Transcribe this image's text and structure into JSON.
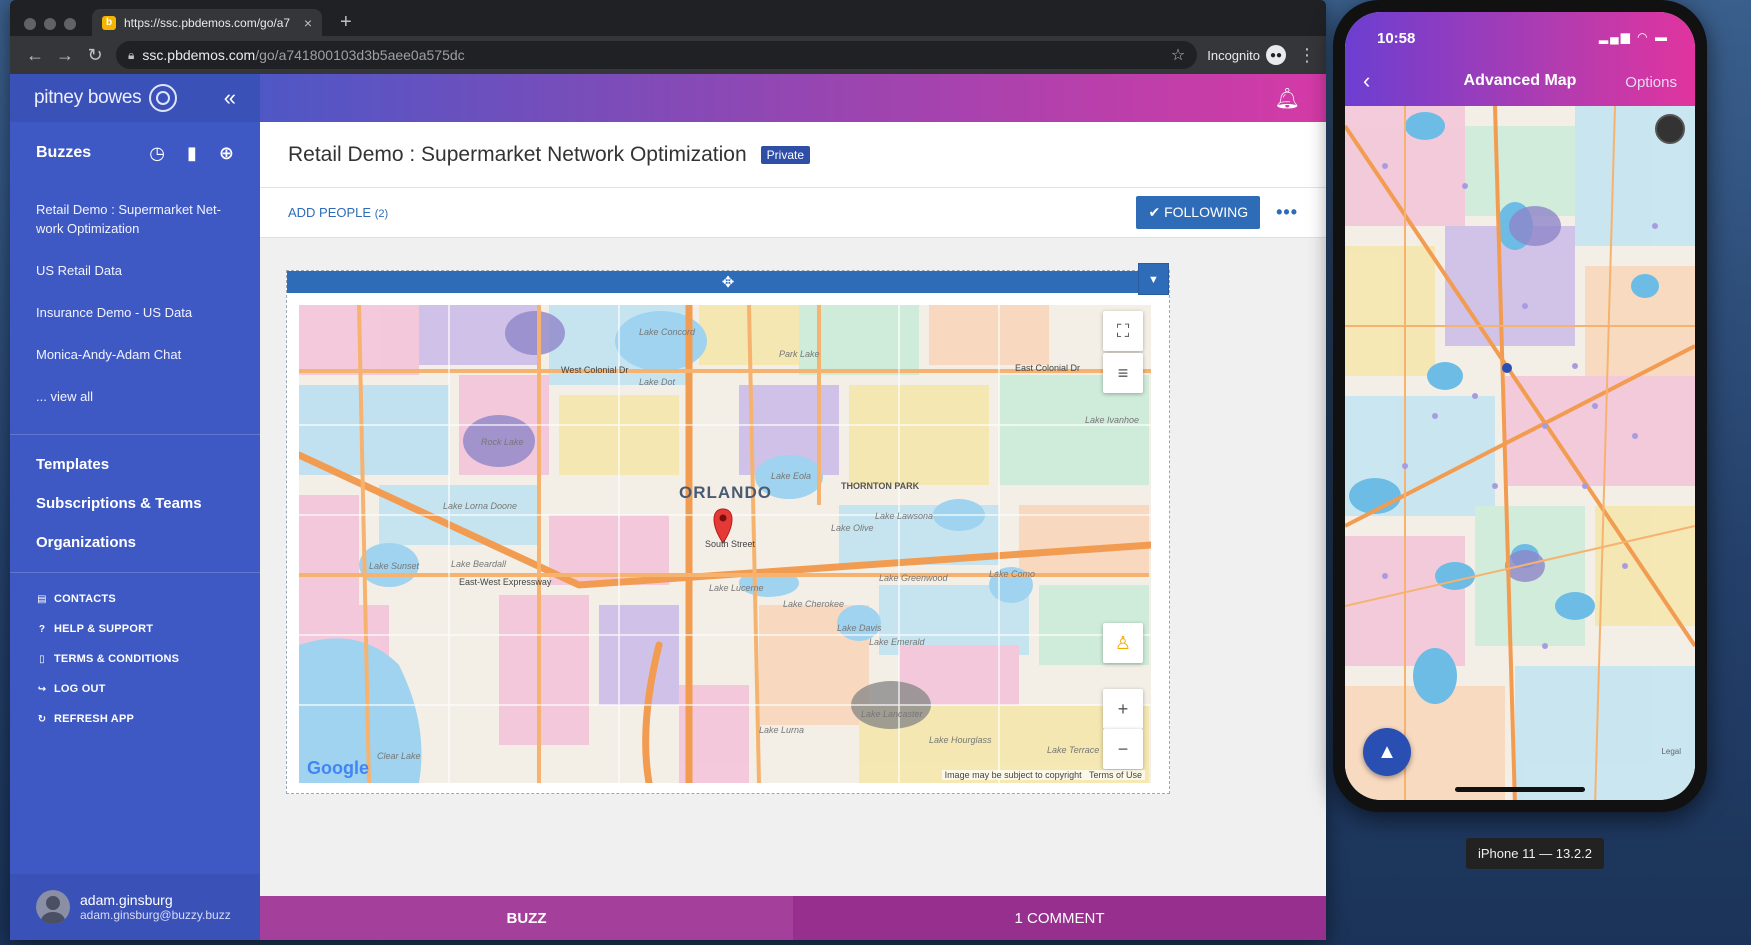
{
  "browser": {
    "tab_title": "https://ssc.pbdemos.com/go/a7",
    "tab_favicon": "b",
    "url_host": "ssc.pbdemos.com",
    "url_path": "/go/a741800103d3b5aee0a575dc",
    "incognito_label": "Incognito"
  },
  "sidebar": {
    "brand": "pitney bowes",
    "section_title": "Buzzes",
    "buzzes": [
      "Retail Demo : Supermarket Net-work Optimization",
      "US Retail Data",
      "Insurance Demo - US Data",
      "Monica-Andy-Adam Chat",
      "... view all"
    ],
    "main_links": [
      "Templates",
      "Subscriptions & Teams",
      "Organizations"
    ],
    "utility_links": [
      {
        "label": "CONTACTS",
        "icon": "book-icon"
      },
      {
        "label": "HELP & SUPPORT",
        "icon": "question-icon"
      },
      {
        "label": "TERMS & CONDITIONS",
        "icon": "document-icon"
      },
      {
        "label": "LOG OUT",
        "icon": "logout-icon"
      },
      {
        "label": "REFRESH APP",
        "icon": "refresh-icon"
      }
    ],
    "user": {
      "name": "adam.ginsburg",
      "email": "adam.ginsburg@buzzy.buzz"
    }
  },
  "main": {
    "title": "Retail Demo : Supermarket Network Optimization",
    "privacy_badge": "Private",
    "add_people_label": "ADD PEOPLE",
    "add_people_count": "(2)",
    "following_label": "FOLLOWING",
    "more_label": "•••"
  },
  "map": {
    "city_label": "ORLANDO",
    "labels": [
      "Lake Concord",
      "Park Lake",
      "Lake Dot",
      "Rock Lake",
      "Lake Eola",
      "THORNTON PARK",
      "Lake Lawsona",
      "Lake Olive",
      "Lake Lorna Doone",
      "Lake Sunset",
      "Lake Beardall",
      "Lake Lucerne",
      "Lake Cherokee",
      "Lake Greenwood",
      "Lake Como",
      "Lake Davis",
      "Lake Emerald",
      "Lake Lancaster",
      "Lake Hourglass",
      "Lake Terrace",
      "Clear Lake",
      "Lake Lurna",
      "Lake Ivanhoe",
      "South Street",
      "East-West Expressway",
      "West Colonial Dr",
      "East Colonial Dr"
    ],
    "copyright": "Image may be subject to copyright",
    "terms": "Terms of Use",
    "google": "Google"
  },
  "bottom": {
    "buzz_label": "BUZZ",
    "comment_label": "1 COMMENT"
  },
  "phone": {
    "time": "10:58",
    "title": "Advanced Map",
    "options_label": "Options",
    "legal": "Legal"
  },
  "simulator_label": "iPhone 11 — 13.2.2",
  "colors": {
    "sidebar": "#3f59c4",
    "accent_blue": "#2f6cb8",
    "magenta": "#d53aa6"
  }
}
